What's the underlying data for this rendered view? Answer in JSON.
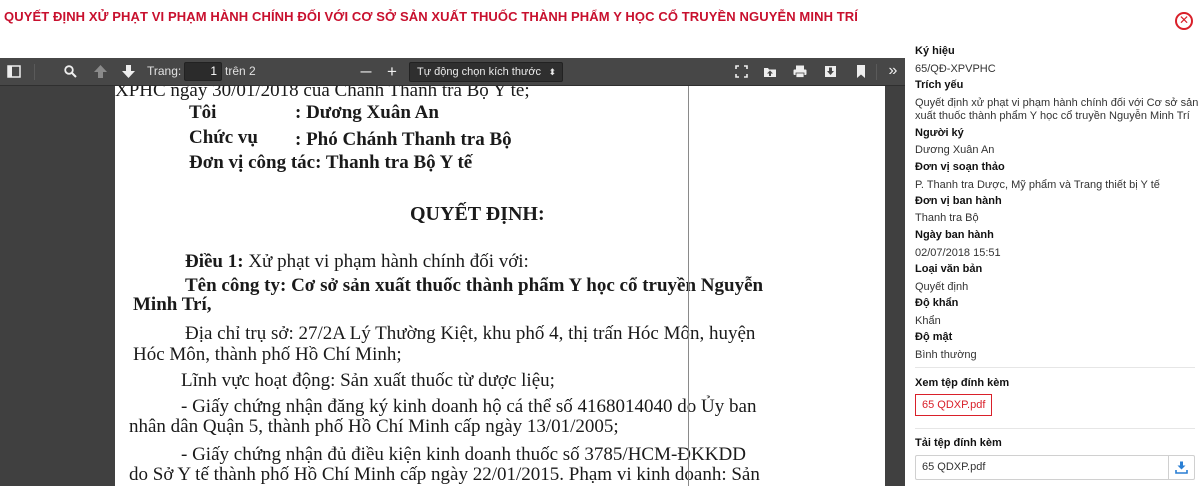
{
  "title": "QUYẾT ĐỊNH XỬ PHẠT VI PHẠM HÀNH CHÍNH ĐỐI VỚI CƠ SỞ SẢN XUẤT THUỐC THÀNH PHẨM Y HỌC CỔ TRUYỀN NGUYỄN MINH TRÍ",
  "close_glyph": "✕",
  "toolbar": {
    "page_label": "Trang:",
    "page_value": "1",
    "page_total": "trên 2",
    "zoom_minus": "—",
    "zoom_plus": "+",
    "zoom_value": "Tự động chọn kích thước",
    "zoom_caret": "⬍",
    "more": "»"
  },
  "icons": {
    "sidebar_toggle": "sidebar-toggle-icon",
    "search": "search-icon",
    "prev": "arrow-up-icon",
    "next": "arrow-down-icon",
    "fullscreen": "fullscreen-icon",
    "open": "open-file-icon",
    "print": "print-icon",
    "download": "download-icon",
    "bookmark": "bookmark-icon"
  },
  "document": {
    "l1": "XPHC ngày 30/01/2018 của Chánh Thanh tra Bộ Y tế;",
    "l2a": "Tôi",
    "l2b": ": Dương Xuân An",
    "l3a": "Chức vụ",
    "l3b": ": Phó Chánh Thanh tra Bộ",
    "l4": "Đơn vị công tác: Thanh tra Bộ Y tế",
    "heading": "QUYẾT ĐỊNH:",
    "d1a": "Điều 1:",
    "d1b": " Xử phạt vi phạm hành chính đối với:",
    "company1": "Tên công ty: Cơ sở sản xuất thuốc thành phẩm Y học cổ truyền Nguyễn",
    "company2": "Minh Trí,",
    "addr1": "Địa chỉ trụ sở: 27/2A Lý Thường Kiệt, khu phố 4, thị trấn Hóc Môn, huyện",
    "addr2": "Hóc Môn, thành phố Hồ Chí Minh;",
    "field": "Lĩnh vực hoạt động: Sản xuất thuốc từ dược liệu;",
    "cert1a": "- Giấy chứng nhận đăng ký kinh doanh hộ cá thể số 4168014040 do Ủy ban",
    "cert1b": "nhân dân Quận 5, thành phố Hồ Chí Minh cấp ngày 13/01/2005;",
    "cert2a": "- Giấy chứng nhận đủ điều kiện kinh doanh thuốc số 3785/HCM-ĐKKDD",
    "cert2b": "do Sở Y tế thành phố Hồ Chí Minh cấp ngày 22/01/2015. Phạm vi kinh doanh: Sản"
  },
  "sidebar": {
    "ky_hieu_label": "Ký hiệu",
    "ky_hieu": "65/QĐ-XPVPHC",
    "trich_yeu_label": "Trích yếu",
    "trich_yeu": "Quyết định xử phạt vi phạm hành chính đối với Cơ sở sản xuất thuốc thành phẩm Y học cổ truyền Nguyễn Minh Trí",
    "nguoi_ky_label": "Người ký",
    "nguoi_ky": "Dương Xuân An",
    "don_vi_soan_label": "Đơn vị soạn thảo",
    "don_vi_soan": "P. Thanh tra Dược, Mỹ phẩm và Trang thiết bị Y tế",
    "don_vi_bh_label": "Đơn vị ban hành",
    "don_vi_bh": "Thanh tra Bộ",
    "ngay_bh_label": "Ngày ban hành",
    "ngay_bh": "02/07/2018 15:51",
    "loai_vb_label": "Loại văn bản",
    "loai_vb": "Quyết định",
    "do_khan_label": "Độ khẩn",
    "do_khan": "Khẩn",
    "do_mat_label": "Độ mật",
    "do_mat": "Bình thường",
    "xem_tep_label": "Xem tệp đính kèm",
    "xem_tep_file": "65 QDXP.pdf",
    "tai_tep_label": "Tải tệp đính kèm",
    "tai_tep_file": "65 QDXP.pdf"
  },
  "colors": {
    "accent": "#c8102e",
    "viewer_bg": "#404040",
    "toolbar_bg": "#474747"
  }
}
